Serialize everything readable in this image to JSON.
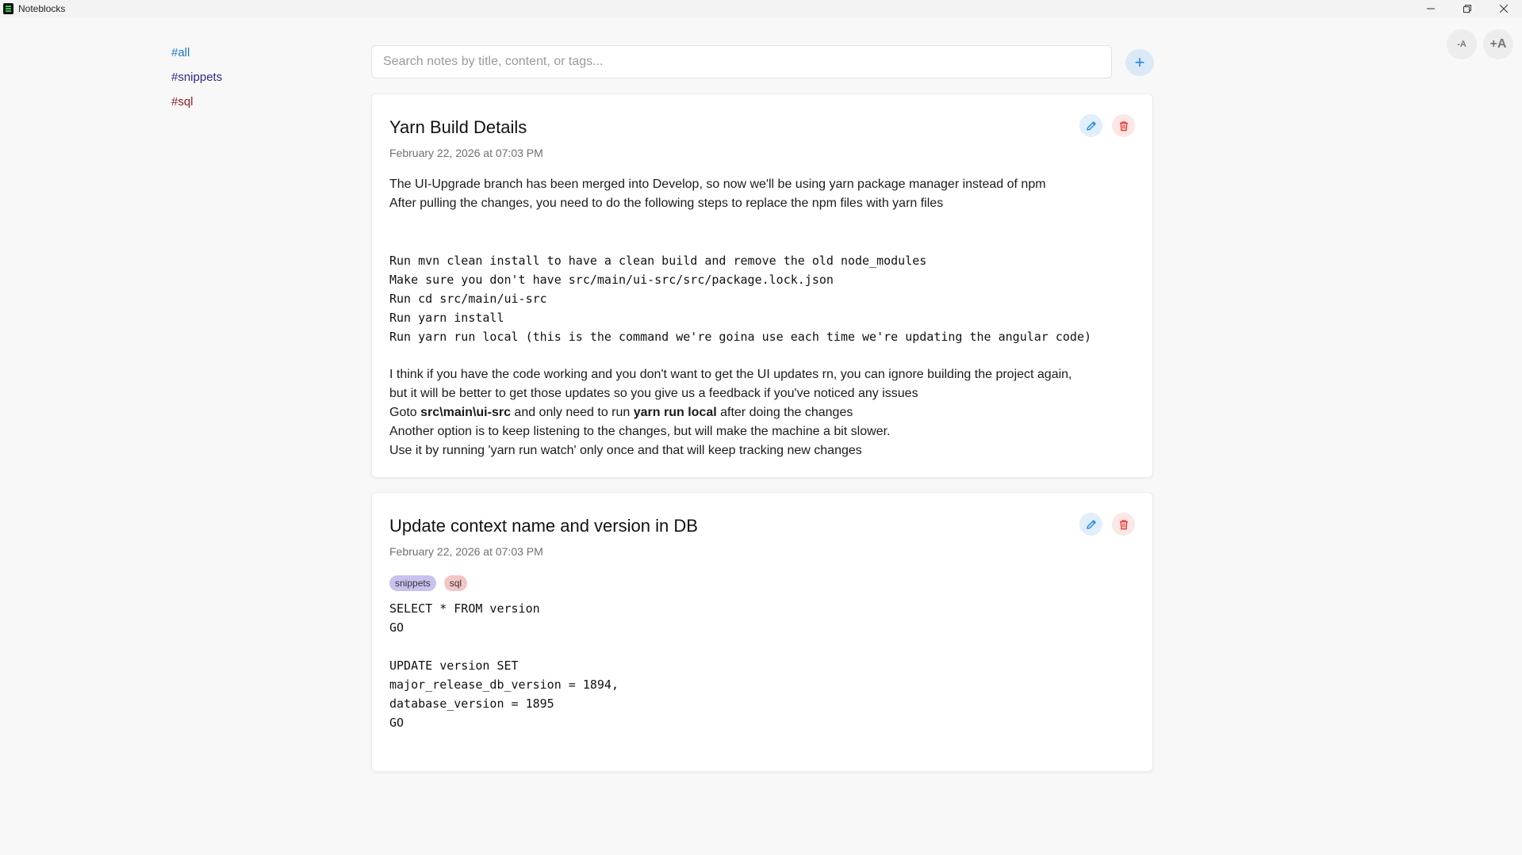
{
  "window": {
    "title": "Noteblocks"
  },
  "sidebar": {
    "tags": [
      {
        "label": "#all"
      },
      {
        "label": "#snippets"
      },
      {
        "label": "#sql"
      }
    ]
  },
  "toolbar": {
    "search_placeholder": "Search notes by title, content, or tags...",
    "add_label": "+",
    "font_smaller_label": "-A",
    "font_larger_label": "+A"
  },
  "notes": [
    {
      "title": "Yarn Build Details",
      "date": "February 22, 2026 at 07:03 PM",
      "lines": {
        "l1": "The UI-Upgrade branch has been merged into Develop, so now we'll be using yarn package manager instead of npm",
        "l2": "After pulling the changes, you need to do the following steps to replace the npm files with yarn files",
        "c1": "Run mvn clean install to have a clean build and remove the old node_modules",
        "c2": "Make sure you don't have src/main/ui-src/src/package.lock.json",
        "c3": "Run cd src/main/ui-src",
        "c4": "Run yarn install",
        "c5": "Run yarn run local (this is the command we're goina use each time we're updating the angular code)",
        "l3": "I think if you have the code working and you don't want to get the UI updates rn, you can ignore building the project again,",
        "l4": "but it will be better to get those updates so you give us a feedback if you've noticed any issues",
        "l5_a": "Goto ",
        "l5_b": "src\\main\\ui-src",
        "l5_c": " and only need to run ",
        "l5_d": "yarn run local",
        "l5_e": " after doing the changes",
        "l6": "Another option is to keep listening to the changes, but will make the machine a bit slower.",
        "l7": "Use it by running 'yarn run watch' only once and that will keep tracking new changes"
      }
    },
    {
      "title": "Update context name and version in DB",
      "date": "February 22, 2026 at 07:03 PM",
      "tags": [
        "snippets",
        "sql"
      ],
      "lines": {
        "c1": "SELECT * FROM version",
        "c2": "GO",
        "c3": "UPDATE version SET",
        "c4": "major_release_db_version = 1894,",
        "c5": "database_version = 1895",
        "c6": "GO"
      }
    }
  ],
  "colors": {
    "accent": "#1e88e5",
    "delete": "#e53935",
    "tag_all": "#1976d2",
    "tag_snippets": "#2a2a8a",
    "tag_sql": "#8b1e1e"
  },
  "icons": {
    "edit": "pencil-icon",
    "delete": "trash-icon",
    "add": "plus-icon"
  }
}
